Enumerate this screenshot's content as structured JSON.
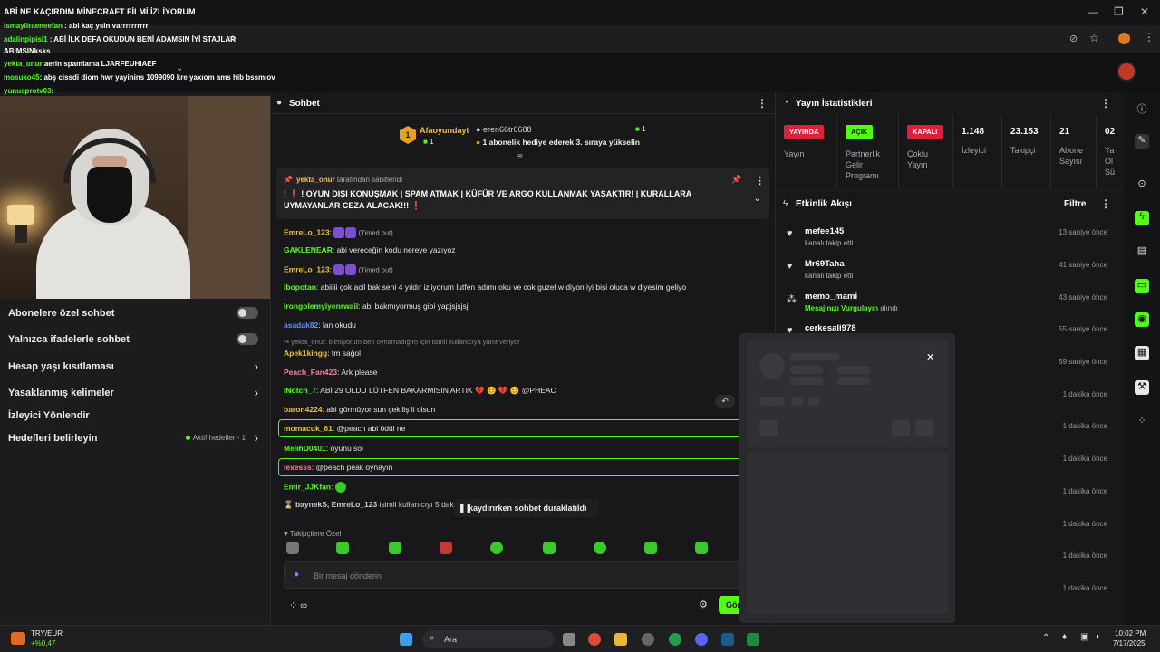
{
  "overlay": {
    "title": "ABİ NE KAÇIRDIM MİNECRAFT FİLMİ İZLİYORUM",
    "lines": [
      {
        "user": "ismayilraeneefan",
        "text": ": abi kaç ysin varrrrrrrrrr"
      },
      {
        "user": "adalinpipisi1",
        "text": ": ABİ İLK DEFA OKUDUN BENİ ADAMSIN İYİ STAJLAR"
      },
      {
        "user": "",
        "text": "ABIMSINksks"
      },
      {
        "user": "yekta_onur",
        "text": "aerin spamlama LJARFEUHIAEF"
      },
      {
        "user": "mosuko45",
        "text": ": abş cissdi diom hwr yayinins 1099090 kre yaxıom ams hib bssmıov"
      },
      {
        "user": "yunusprotv03",
        "text": ":"
      }
    ]
  },
  "settings": {
    "rows": [
      {
        "label": "Abonelere özel sohbet",
        "kind": "toggle"
      },
      {
        "label": "Yalnızca ifadelerle sohbet",
        "kind": "toggle"
      },
      {
        "label": "Hesap yaşı kısıtlaması",
        "kind": "chev"
      },
      {
        "label": "Yasaklanmış kelimeler",
        "kind": "chev"
      },
      {
        "label": "İzleyici Yönlendir",
        "kind": "none"
      },
      {
        "label": "Hedefleri belirleyin",
        "kind": "chev"
      }
    ],
    "aktif": "Aktif hedefler - 1"
  },
  "chat": {
    "title": "Sohbet",
    "gift": {
      "top_user": "Afaoyundayt",
      "top_count": "1",
      "rank": "1",
      "gifter": "eren66tr6688",
      "gifter_count": "1",
      "message": "1 abonelik hediye ederek 3. sıraya yükselin"
    },
    "pinned": {
      "by_user": "yekta_onur",
      "by_text": "tarafından sabitlendi",
      "text": "! ❗ ! OYUN DIŞI KONUŞMAK | SPAM ATMAK | KÜFÜR VE ARGO KULLANMAK YASAKTIR! | KURALLARA UYMAYANLAR CEZA ALACAK!!! ❗"
    },
    "messages": [
      {
        "user": "EmreLo_123",
        "text": "(Timed out)",
        "color": "#e8c040"
      },
      {
        "user": "GAKLENEAR",
        "text": "abi vereceğin kodu nereye yazıyoz",
        "color": "#53fc18"
      },
      {
        "user": "EmreLo_123",
        "text": "(Timed out)",
        "color": "#e8c040"
      },
      {
        "user": "ibopotan",
        "text": "abiiiii çok acil bak seni 4 yıldır izliyorum lutfen adımı oku ve cok guzel w diyon iyi bişi oluca w diyesim geliyo",
        "color": "#53fc18"
      },
      {
        "user": "Irongolemyiyenrwail",
        "text": "abi bakmıyormuş gibi yapjsjsjsj",
        "color": "#53fc18"
      },
      {
        "user": "asadak82",
        "text": "lan okudu",
        "color": "#6a8cff"
      },
      {
        "user": "",
        "text": "yekta_onur: bilmiyorum ben oynamadığım için isimli kullanıcıya yanıt veriyor",
        "color": "#888"
      },
      {
        "user": "Apek1kingg",
        "text": "tm sağol",
        "color": "#e8c040"
      },
      {
        "user": "Peach_Fan423",
        "text": "Ark please",
        "color": "#ff7b9c"
      },
      {
        "user": "INotch_7",
        "text": "ABİ 29 OLDU LÜTFEN BAKARMISIN ARTIK 💔 😊 💔 😊 @PHEAC",
        "color": "#53fc18"
      },
      {
        "user": "baron4224",
        "text": "abi görmüyor sun çekiliş li olsun",
        "color": "#e8c040"
      },
      {
        "user": "momacuk_61",
        "text": "@peach abi ödül ne",
        "color": "#e8c040"
      },
      {
        "user": "MelihD0401",
        "text": "oyunu sol",
        "color": "#53fc18"
      },
      {
        "user": "lexesss",
        "text": "@peach peak oynayın",
        "color": "#ff7b9c"
      },
      {
        "user": "Emir_JJKfan",
        "text": "",
        "color": "#53fc18"
      },
      {
        "user": "baynekS, EmreLo_123",
        "text": "isimli kullanıcıyı 5 daki",
        "color": "#ddd"
      }
    ],
    "paused": "kaydırırken sohbet duraklatıldı",
    "followers_only": "Takipçilere Özel",
    "placeholder": "Bir mesaj gönderin",
    "send": "Gön"
  },
  "stats": {
    "title": "Yayın İstatistikleri",
    "cells": [
      {
        "pill": "YAYINDA",
        "label": "Yayın",
        "pill_color": "#e0203a"
      },
      {
        "pill": "AÇIK",
        "label": "Partnerlik Gelir Programı",
        "pill_color": "#53fc18"
      },
      {
        "pill": "KAPALI",
        "label": "Çoklu Yayın",
        "pill_color": "#e0203a"
      },
      {
        "num": "1.148",
        "label": "İzleyici"
      },
      {
        "num": "23.153",
        "label": "Takipçi"
      },
      {
        "num": "21",
        "label": "Abone Sayısı"
      },
      {
        "num": "02",
        "label": "Ya Ol Sü"
      }
    ]
  },
  "activity": {
    "title": "Etkinlik Akışı",
    "filter": "Filtre",
    "items": [
      {
        "name": "mefee145",
        "sub": "kanalı takip etti",
        "time": "13 saniye önce",
        "icon": "heart-icon"
      },
      {
        "name": "Mr69Taha",
        "sub": "kanalı takip etti",
        "time": "41 saniye önce",
        "icon": "heart-icon"
      },
      {
        "name": "memo_mami",
        "sub_hl": "Mesajınızı Vurgulayın",
        "sub": "alındı",
        "time": "43 saniye önce",
        "icon": "sparkle-icon"
      },
      {
        "name": "cerkesali978",
        "sub": "",
        "time": "55 saniye önce",
        "icon": "heart-icon"
      },
      {
        "name": "",
        "sub": "",
        "time": "59 saniye önce"
      },
      {
        "name": "",
        "sub": "",
        "time": "1 dakika önce"
      },
      {
        "name": "",
        "sub": "",
        "time": "1 dakika önce"
      },
      {
        "name": "",
        "sub": "",
        "time": "1 dakika önce"
      },
      {
        "name": "",
        "sub": "",
        "time": "1 dakika önce"
      },
      {
        "name": "",
        "sub": "",
        "time": "1 dakika önce"
      },
      {
        "name": "",
        "sub": "",
        "time": "1 dakika önce"
      },
      {
        "name": "",
        "sub": "",
        "time": "1 dakika önce"
      }
    ]
  },
  "taskbar": {
    "ticker": "TRY/EUR",
    "change": "+%0,47",
    "search": "Ara",
    "time": "10:02 PM",
    "date": "7/17/2025"
  },
  "browser": {
    "url_fragment": "ch"
  }
}
